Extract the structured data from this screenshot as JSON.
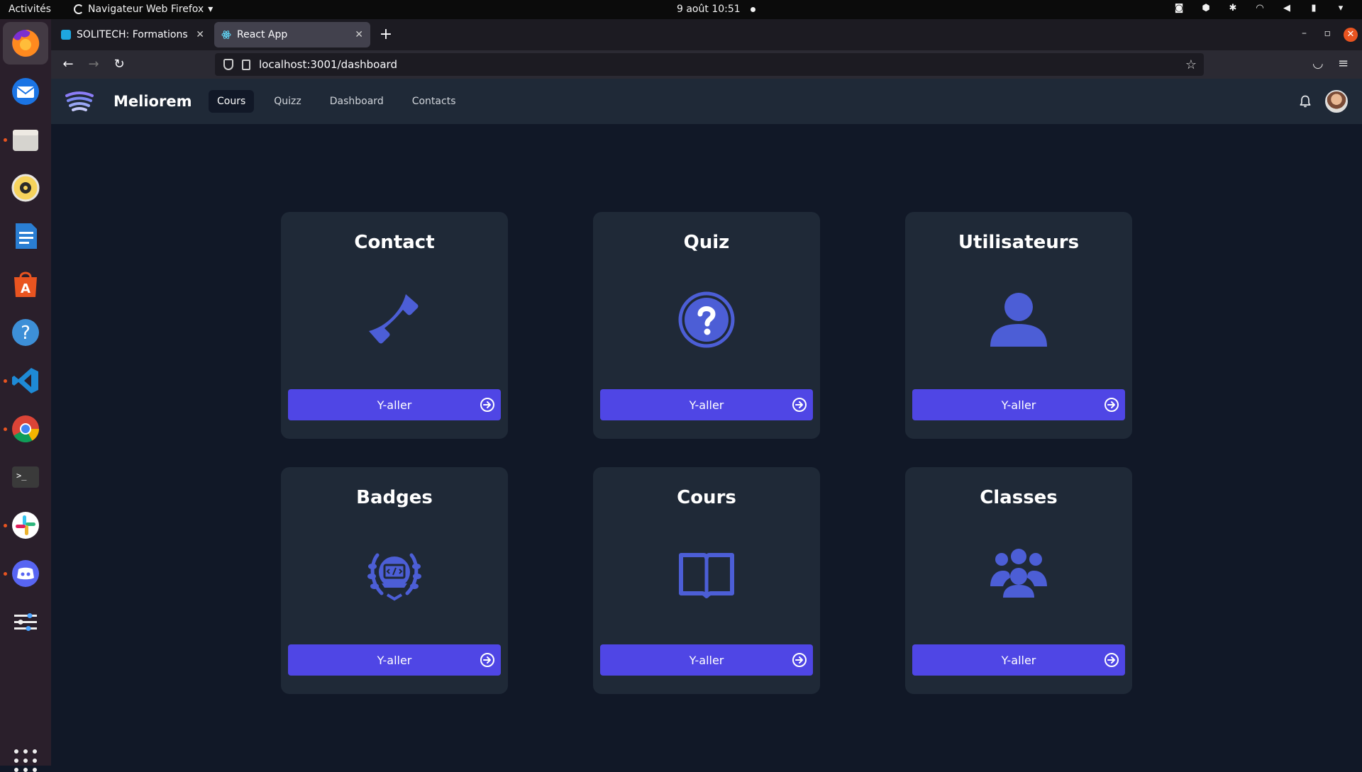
{
  "topbar": {
    "activities": "Activités",
    "app_menu": "Navigateur Web Firefox",
    "clock": "9 août  10:51"
  },
  "dock": {
    "items": [
      "firefox-icon",
      "thunderbird-icon",
      "files-icon",
      "rhythmbox-icon",
      "writer-icon",
      "app-center-icon",
      "help-icon",
      "vscode-icon",
      "chrome-icon",
      "terminal-icon",
      "slack-icon",
      "discord-icon",
      "settings-icon"
    ]
  },
  "browser": {
    "tabs": [
      {
        "label": "SOLITECH: Formations"
      },
      {
        "label": "React App"
      }
    ],
    "url": "localhost:3001/dashboard"
  },
  "app": {
    "brand": "Meliorem",
    "nav": [
      "Cours",
      "Quizz",
      "Dashboard",
      "Contacts"
    ],
    "active_nav": "Cours"
  },
  "cards": [
    {
      "title": "Contact",
      "icon": "phone-icon",
      "button": "Y-aller"
    },
    {
      "title": "Quiz",
      "icon": "question-circle-icon",
      "button": "Y-aller"
    },
    {
      "title": "Utilisateurs",
      "icon": "user-icon",
      "button": "Y-aller"
    },
    {
      "title": "Badges",
      "icon": "badge-laurel-icon",
      "button": "Y-aller"
    },
    {
      "title": "Cours",
      "icon": "book-icon",
      "button": "Y-aller"
    },
    {
      "title": "Classes",
      "icon": "group-icon",
      "button": "Y-aller"
    }
  ],
  "colors": {
    "page_bg": "#111827",
    "card_bg": "#1f2937",
    "accent": "#4f46e5",
    "icon": "#4c5ed6"
  }
}
